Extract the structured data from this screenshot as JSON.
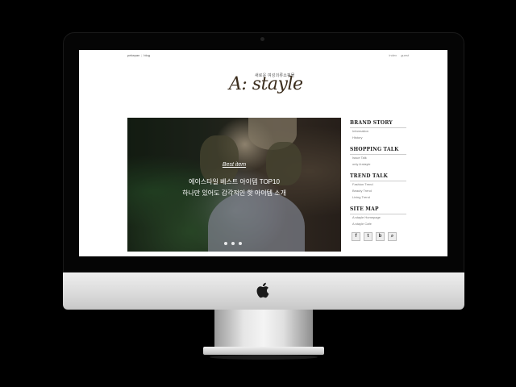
{
  "topbar": {
    "left_links": [
      "pekepan",
      "blog"
    ],
    "right_links": [
      "index",
      "guest"
    ]
  },
  "brand": {
    "tagline": "새로운 여성의류쇼핑몰",
    "logo": "A: stayle"
  },
  "hero": {
    "tag": "Best item",
    "line1": "에이스타일 베스트 아이템 TOP10",
    "line2": "하나만 있어도 감각적인 핫 아이템 소개",
    "slides": 3
  },
  "sidebar": {
    "sections": [
      {
        "title": "BRAND STORY",
        "items": [
          "Information",
          "History"
        ]
      },
      {
        "title": "SHOPPING TALK",
        "items": [
          "Issue Talk",
          "only A:stayle"
        ]
      },
      {
        "title": "TREND TALK",
        "items": [
          "Fashion Trend",
          "Beauty Trend",
          "Living Trend"
        ]
      },
      {
        "title": "SITE MAP",
        "items": [
          "A:stayle Homepage",
          "A:stayle Cafe"
        ]
      }
    ],
    "social_icons": [
      "facebook-icon",
      "twitter-icon",
      "blog-icon",
      "search-icon"
    ],
    "social_glyphs": [
      "f",
      "t",
      "b",
      "⌕"
    ]
  }
}
